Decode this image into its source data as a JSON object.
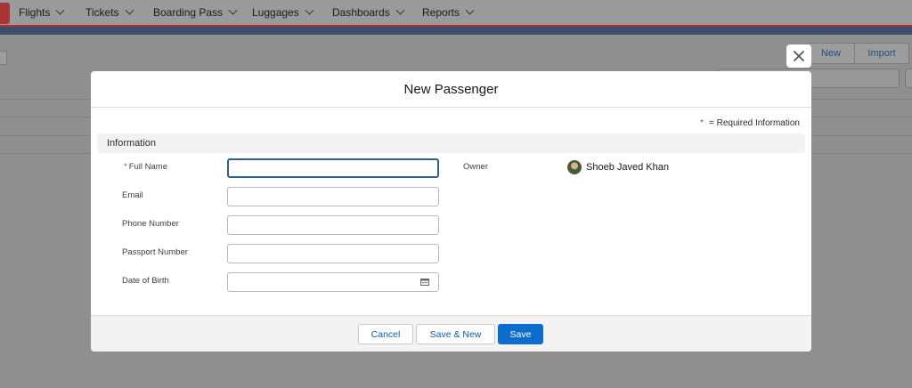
{
  "nav": {
    "items": [
      {
        "label": "Flights"
      },
      {
        "label": "Tickets"
      },
      {
        "label": "Boarding Pass"
      },
      {
        "label": "Luggages"
      },
      {
        "label": "Dashboards"
      },
      {
        "label": "Reports"
      }
    ]
  },
  "background": {
    "new_label": "New",
    "import_label": "Import"
  },
  "modal": {
    "title": "New Passenger",
    "required_note": "= Required Information",
    "required_star": "*",
    "section_title": "Information",
    "fields": [
      {
        "label": "Full Name",
        "required": "*",
        "value": ""
      },
      {
        "label": "Email",
        "value": ""
      },
      {
        "label": "Phone Number",
        "value": ""
      },
      {
        "label": "Passport Number",
        "value": ""
      },
      {
        "label": "Date of Birth",
        "value": ""
      }
    ],
    "owner": {
      "label": "Owner",
      "name": "Shoeb Javed Khan"
    },
    "footer": {
      "cancel_label": "Cancel",
      "save_new_label": "Save & New",
      "save_label": "Save"
    }
  },
  "colors": {
    "brand": "#0b6ecf",
    "required": "#c23934",
    "nav_accent": "#b03030"
  }
}
